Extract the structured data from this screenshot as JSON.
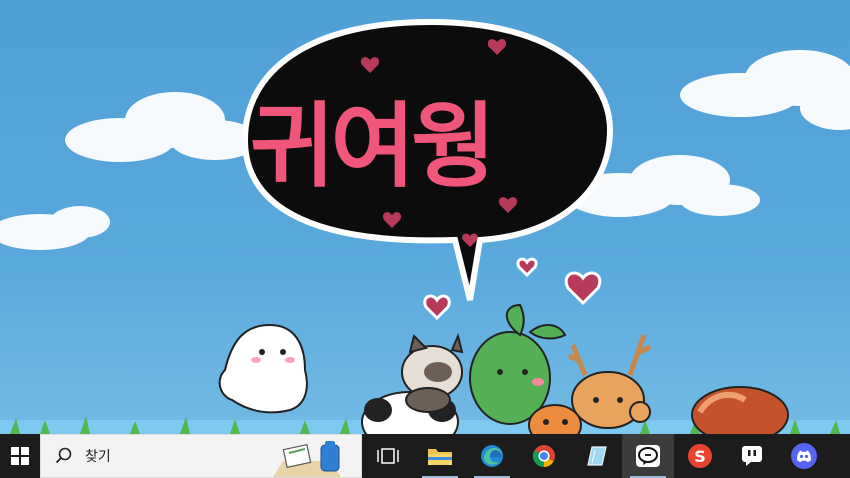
{
  "wallpaper": {
    "speech_bubble_text": "귀여웡",
    "colors": {
      "sky": "#5aa9dd",
      "bubble_fill": "#0c0c0c",
      "text": "#f0557a",
      "hearts": "#b83a5a"
    },
    "characters": [
      "ghost-character",
      "cat-character",
      "panda-character",
      "sprout-character",
      "squirrel-character",
      "deer-character",
      "red-panda-character"
    ]
  },
  "taskbar": {
    "start_icon": "windows-icon",
    "search": {
      "placeholder": "찾기",
      "icon": "search-icon"
    },
    "apps": [
      {
        "name": "task-view",
        "icon": "task-view-icon"
      },
      {
        "name": "file-explorer",
        "icon": "folder-icon"
      },
      {
        "name": "edge",
        "icon": "edge-icon"
      },
      {
        "name": "chrome",
        "icon": "chrome-icon"
      },
      {
        "name": "notes",
        "icon": "notes-icon"
      },
      {
        "name": "line",
        "icon": "line-icon"
      },
      {
        "name": "s-app",
        "icon": "s-app-icon"
      },
      {
        "name": "messenger",
        "icon": "chat-icon"
      },
      {
        "name": "discord",
        "icon": "discord-icon"
      }
    ]
  }
}
